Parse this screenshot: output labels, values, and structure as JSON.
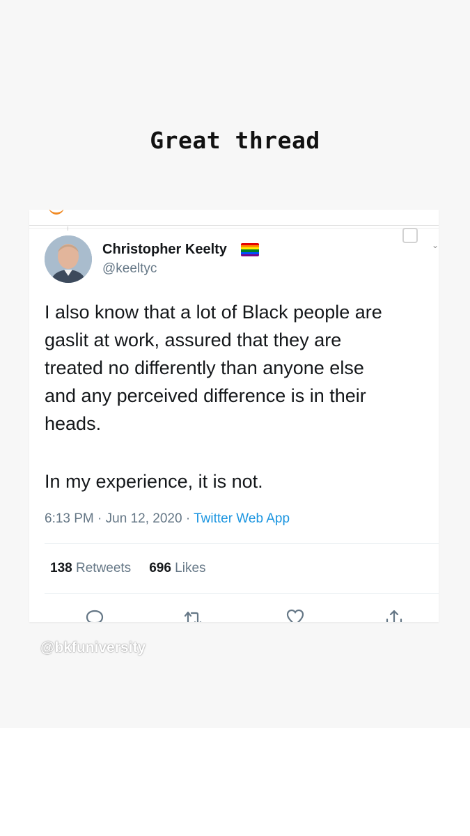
{
  "story": {
    "caption": "Great thread",
    "watermark": "@bkfuniversity"
  },
  "tweet": {
    "author_name": "Christopher Keelty",
    "author_handle": "@keeltyc",
    "author_badge": "rainbow-flag-icon",
    "text": "I also know that a lot of Black people are\ngaslit at work, assured that they are\ntreated no differently than anyone else\nand any perceived difference is in their\nheads.",
    "text_2": "In my experience, it is not.",
    "time": "6:13 PM",
    "separator": "·",
    "date": "Jun 12, 2020",
    "source": "Twitter Web App",
    "retweets_count": "138",
    "retweets_label": "Retweets",
    "likes_count": "696",
    "likes_label": "Likes",
    "actions": [
      "reply-icon",
      "retweet-icon",
      "like-icon",
      "share-icon"
    ]
  },
  "colors": {
    "link": "#1b95e0",
    "secondary_text": "#657786",
    "primary_text": "#14171a",
    "flag": [
      "#e40303",
      "#ff8c00",
      "#ffed00",
      "#008026",
      "#004dff",
      "#750787"
    ]
  }
}
